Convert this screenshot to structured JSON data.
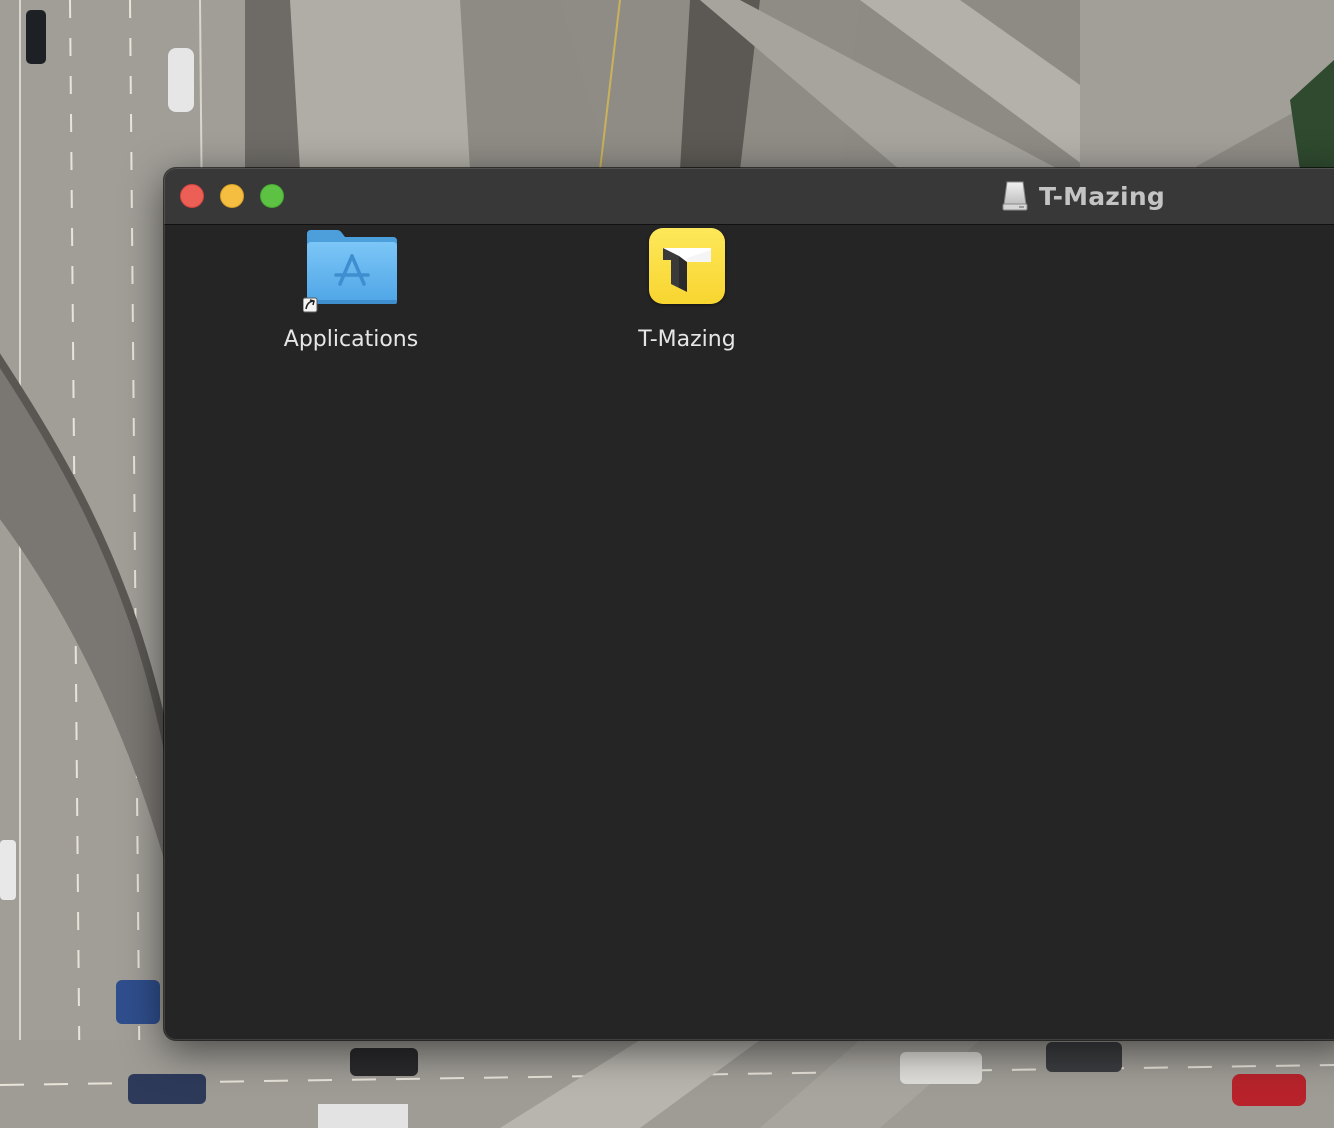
{
  "window": {
    "title": "T-Mazing",
    "title_icon": "external-disk-icon",
    "traffic_lights": {
      "close_color": "#ec5f57",
      "minimize_color": "#f5be40",
      "zoom_color": "#5dc244"
    }
  },
  "items": [
    {
      "label": "Applications",
      "icon": "applications-folder-alias-icon"
    },
    {
      "label": "T-Mazing",
      "icon": "t-mazing-app-icon"
    }
  ],
  "colors": {
    "window_background": "#252525",
    "titlebar_background": "#383838",
    "app_icon_yellow": "#f8d530",
    "folder_blue": "#5fb4ee"
  }
}
